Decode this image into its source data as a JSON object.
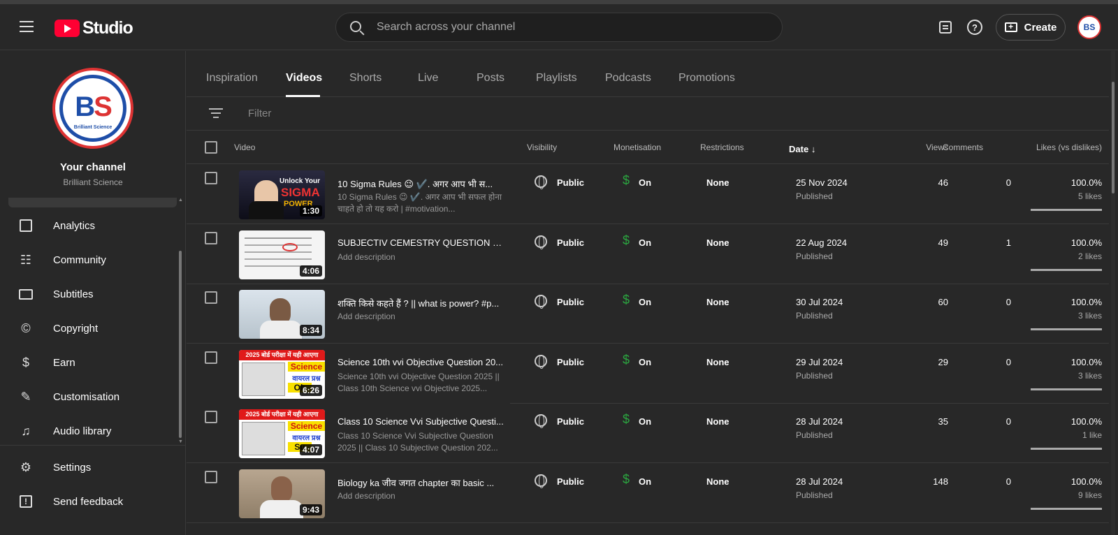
{
  "header": {
    "logo_text": "Studio",
    "search_placeholder": "Search across your channel",
    "create_label": "Create",
    "avatar_initials": "BS",
    "help_glyph": "?"
  },
  "sidebar": {
    "your_channel": "Your channel",
    "channel_name": "Brilliant Science",
    "avatar_logo": {
      "b": "B",
      "s": "S",
      "sub": "Brilliant Science"
    },
    "items": [
      {
        "label": "Analytics",
        "icon": "analytics-icon"
      },
      {
        "label": "Community",
        "icon": "community-icon"
      },
      {
        "label": "Subtitles",
        "icon": "subtitles-icon"
      },
      {
        "label": "Copyright",
        "icon": "copyright-icon"
      },
      {
        "label": "Earn",
        "icon": "earn-icon"
      },
      {
        "label": "Customisation",
        "icon": "customisation-icon"
      },
      {
        "label": "Audio library",
        "icon": "audio-library-icon"
      }
    ],
    "bottom_items": [
      {
        "label": "Settings",
        "icon": "gear-icon"
      },
      {
        "label": "Send feedback",
        "icon": "feedback-icon"
      }
    ]
  },
  "tabs": [
    {
      "label": "Inspiration"
    },
    {
      "label": "Videos",
      "active": true
    },
    {
      "label": "Shorts"
    },
    {
      "label": "Live"
    },
    {
      "label": "Posts"
    },
    {
      "label": "Playlists"
    },
    {
      "label": "Podcasts"
    },
    {
      "label": "Promotions"
    }
  ],
  "filter": {
    "label": "Filter"
  },
  "table": {
    "headers": {
      "video": "Video",
      "visibility": "Visibility",
      "monetisation": "Monetisation",
      "restrictions": "Restrictions",
      "date": "Date",
      "views": "Views",
      "comments": "Comments",
      "likes": "Likes (vs dislikes)"
    },
    "rows": [
      {
        "title": "10 Sigma Rules 😉 ✔️. अगर आप भी स...",
        "description": "10 Sigma Rules 😉 ✔️. अगर आप भी सफल होना चाहते हो तो यह करो | #motivation...",
        "duration": "1:30",
        "visibility": "Public",
        "monetisation": "On",
        "restrictions": "None",
        "date": "25 Nov 2024",
        "status": "Published",
        "views": "46",
        "comments": "0",
        "likes_pct": "100.0%",
        "likes_count": "5 likes",
        "like_ratio": 1.0,
        "thumb_color": "#1a1a2a",
        "thumb_text": [
          "Unlock Your",
          "SIGMA",
          "POWER"
        ]
      },
      {
        "title": "SUBJECTIV CEMESTRY QUESTION PA...",
        "description": "Add description",
        "duration": "4:06",
        "visibility": "Public",
        "monetisation": "On",
        "restrictions": "None",
        "date": "22 Aug 2024",
        "status": "Published",
        "views": "49",
        "comments": "1",
        "likes_pct": "100.0%",
        "likes_count": "2 likes",
        "like_ratio": 1.0,
        "thumb_color": "#f2f2f2",
        "thumb_text": []
      },
      {
        "title": "शक्ति किसे कहते हैं ? || what is power? #p...",
        "description": "Add description",
        "duration": "8:34",
        "visibility": "Public",
        "monetisation": "On",
        "restrictions": "None",
        "date": "30 Jul 2024",
        "status": "Published",
        "views": "60",
        "comments": "0",
        "likes_pct": "100.0%",
        "likes_count": "3 likes",
        "like_ratio": 1.0,
        "thumb_color": "#cfd8e0",
        "thumb_text": []
      },
      {
        "title": "Science 10th vvi Objective Question 20...",
        "description": "Science 10th vvi Objective Question 2025 || Class 10th Science vvi Objective 2025...",
        "duration": "6:26",
        "visibility": "Public",
        "monetisation": "On",
        "restrictions": "None",
        "date": "29 Jul 2024",
        "status": "Published",
        "views": "29",
        "comments": "0",
        "likes_pct": "100.0%",
        "likes_count": "3 likes",
        "like_ratio": 1.0,
        "thumb_color": "#ffffff",
        "thumb_text": [
          "2025 बोर्ड परीक्षा में यही आएगा",
          "Science",
          "वायरल प्रश्न",
          "Ob"
        ]
      },
      {
        "title": "Class 10 Science Vvi Subjective Questi...",
        "description": "Class 10 Science Vvi Subjective Question 2025 || Class 10 Subjective Question 202...",
        "duration": "4:07",
        "visibility": "Public",
        "monetisation": "On",
        "restrictions": "None",
        "date": "28 Jul 2024",
        "status": "Published",
        "views": "35",
        "comments": "0",
        "likes_pct": "100.0%",
        "likes_count": "1 like",
        "like_ratio": 1.0,
        "thumb_color": "#ffffff",
        "thumb_text": [
          "2025 बोर्ड परीक्षा में यही आएगा",
          "Science",
          "वायरल प्रश्न",
          "Su"
        ]
      },
      {
        "title": "Biology ka जीव जगत chapter का basic ...",
        "description": "Add description",
        "duration": "9:43",
        "visibility": "Public",
        "monetisation": "On",
        "restrictions": "None",
        "date": "28 Jul 2024",
        "status": "Published",
        "views": "148",
        "comments": "0",
        "likes_pct": "100.0%",
        "likes_count": "9 likes",
        "like_ratio": 1.0,
        "thumb_color": "#a89a88",
        "thumb_text": []
      }
    ]
  },
  "colors": {
    "background": "#282828",
    "accent_red": "#ff0033",
    "money_green": "#2ba640",
    "brand_blue": "#1e4ea8"
  }
}
